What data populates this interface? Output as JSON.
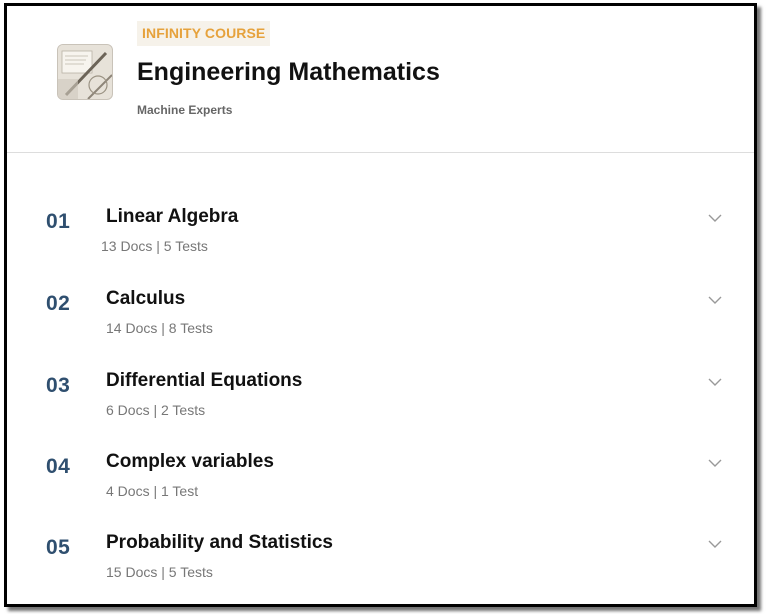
{
  "course": {
    "badge": "INFINITY COURSE",
    "title": "Engineering Mathematics",
    "author": "Machine Experts",
    "thumbnail_icon": "course-thumbnail-image"
  },
  "chapters": [
    {
      "number": "01",
      "title": "Linear Algebra",
      "meta": "13 Docs | 5 Tests"
    },
    {
      "number": "02",
      "title": "Calculus",
      "meta": "14 Docs | 8 Tests"
    },
    {
      "number": "03",
      "title": "Differential Equations",
      "meta": "6 Docs | 2 Tests"
    },
    {
      "number": "04",
      "title": "Complex variables",
      "meta": "4 Docs | 1 Test"
    },
    {
      "number": "05",
      "title": "Probability and Statistics",
      "meta": "15 Docs | 5 Tests"
    }
  ],
  "colors": {
    "badge_text": "#e6a23c",
    "badge_bg": "#f6f2ea",
    "chapter_number": "#2f4f6f",
    "chevron": "#999999"
  }
}
